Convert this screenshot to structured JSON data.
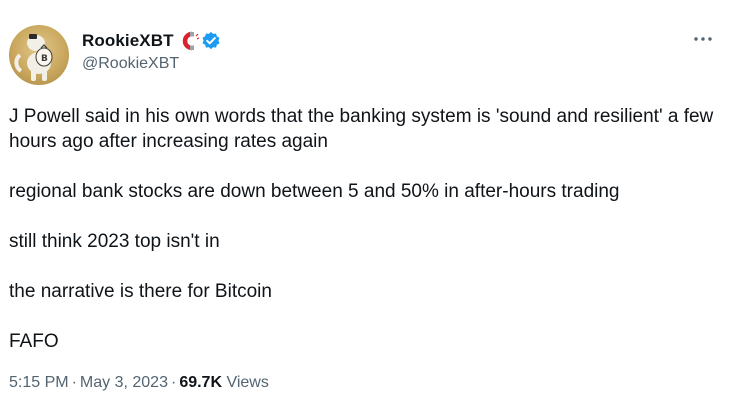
{
  "author": {
    "display_name": "RookieXBT",
    "handle": "@RookieXBT",
    "verified": true,
    "avatar": "cartoon-character-with-bitcoin-bag",
    "badge_icon": "magnet-icon"
  },
  "menu": {
    "icon": "more-icon"
  },
  "tweet": {
    "paragraphs": [
      "J Powell said in his own words that the banking system is 'sound and resilient' a few hours ago after increasing rates again",
      "regional bank stocks are down between 5 and 50% in after-hours trading",
      "still think 2023 top isn't in",
      "the narrative is there for Bitcoin",
      "FAFO"
    ]
  },
  "meta": {
    "time": "5:15 PM",
    "separator": "·",
    "date": "May 3, 2023",
    "views_count": "69.7K",
    "views_label": "Views"
  },
  "colors": {
    "text": "#0f1419",
    "secondary": "#536471",
    "verified": "#1d9bf0",
    "magnet_red": "#d9232e"
  }
}
